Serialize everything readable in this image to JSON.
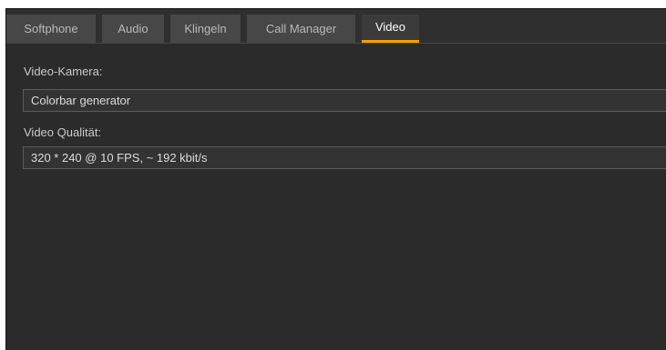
{
  "tabs": [
    {
      "label": "Softphone",
      "active": false
    },
    {
      "label": "Audio",
      "active": false
    },
    {
      "label": "Klingeln",
      "active": false
    },
    {
      "label": "Call Manager",
      "active": false
    },
    {
      "label": "Video",
      "active": true
    }
  ],
  "video_settings": {
    "camera_label": "Video-Kamera:",
    "camera_value": "Colorbar generator",
    "quality_label": "Video Qualität:",
    "quality_value": "320 * 240 @ 10 FPS, ~ 192 kbit/s"
  },
  "colors": {
    "panel_background": "#2b2b2b",
    "tab_background": "#474747",
    "active_tab_indicator": "#f3a000"
  }
}
